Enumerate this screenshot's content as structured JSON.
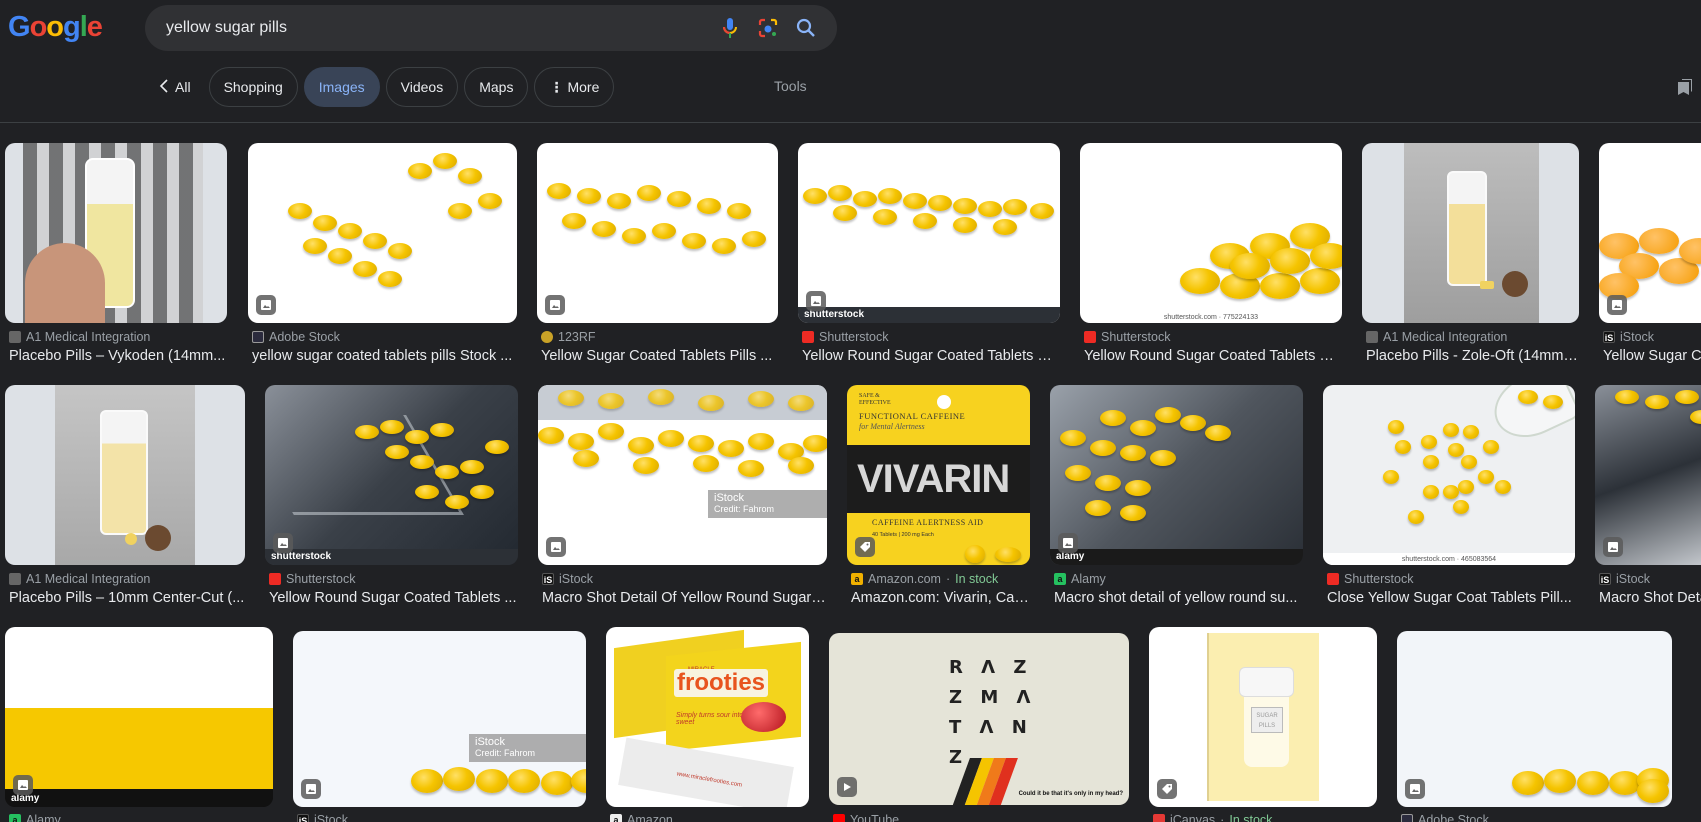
{
  "header": {
    "logo_letters": [
      "G",
      "o",
      "o",
      "g",
      "l",
      "e"
    ],
    "search": {
      "value": "yellow sugar pills",
      "placeholder": ""
    },
    "icons": {
      "voice": "microphone-icon",
      "lens": "lens-camera-icon",
      "search": "search-icon"
    }
  },
  "tabs": {
    "back_label": "All",
    "chips": [
      {
        "label": "Shopping",
        "active": false
      },
      {
        "label": "Images",
        "active": true
      },
      {
        "label": "Videos",
        "active": false
      },
      {
        "label": "Maps",
        "active": false
      },
      {
        "label": "More",
        "active": false
      }
    ],
    "tools_label": "Tools",
    "saved_icon": "saved-bookmarks-icon"
  },
  "colors": {
    "background": "#202124",
    "active_chip_bg": "#394457",
    "active_chip_text": "#8ab4f8",
    "in_stock": "#81c995",
    "pill_yellow": "#f5c400"
  },
  "results": {
    "row1": [
      {
        "source": "A1 Medical Integration",
        "title": "Placebo Pills – Vykoden (14mm...",
        "badge": "image-icon"
      },
      {
        "source": "Adobe Stock",
        "title": "yellow sugar coated tablets pills Stock ...",
        "badge": "image-icon"
      },
      {
        "source": "123RF",
        "title": "Yellow Sugar Coated Tablets Pills ...",
        "badge": "image-icon"
      },
      {
        "source": "Shutterstock",
        "title": "Yellow Round Sugar Coated Tablets Pi...",
        "badge": "image-icon",
        "watermark": "shutterstock"
      },
      {
        "source": "Shutterstock",
        "title": "Yellow Round Sugar Coated Tablets Pi...",
        "watermark": "shutterstock.com · 775224133"
      },
      {
        "source": "A1 Medical Integration",
        "title": "Placebo Pills - Zole-Oft (14mm ..."
      },
      {
        "source": "iStock",
        "title": "Yellow Sugar Co",
        "badge": "image-icon"
      }
    ],
    "row2": [
      {
        "source": "A1 Medical Integration",
        "title": "Placebo Pills – 10mm Center-Cut (..."
      },
      {
        "source": "Shutterstock",
        "title": "Yellow Round Sugar Coated Tablets ...",
        "badge": "image-icon",
        "watermark": "shutterstock"
      },
      {
        "source": "iStock",
        "title": "Macro Shot Detail Of Yellow Round Sugar ...",
        "badge": "image-icon",
        "overlay_title": "iStock",
        "overlay_credit": "Credit: Fahrom"
      },
      {
        "source": "Amazon.com",
        "stock": "In stock",
        "title": "Amazon.com: Vivarin, Caf...",
        "badge": "price-tag-icon",
        "product": {
          "tag1": "SAFE &",
          "tag2": "EFFECTIVE",
          "line1": "FUNCTIONAL CAFFEINE",
          "line2": "for Mental Alertness",
          "brand": "VIVARIN",
          "subtitle": "CAFFEINE ALERTNESS AID",
          "count": "40 Tablets | 200 mg Each"
        }
      },
      {
        "source": "Alamy",
        "title": "Macro shot detail of yellow round su...",
        "badge": "image-icon",
        "watermark": "alamy"
      },
      {
        "source": "Shutterstock",
        "title": "Close Yellow Sugar Coat Tablets Pill...",
        "watermark": "shutterstock.com · 465083564"
      },
      {
        "source": "iStock",
        "title": "Macro Shot Deta",
        "badge": "image-icon"
      }
    ],
    "row3": [
      {
        "source": "Alamy",
        "badge": "image-icon",
        "watermark": "alamy"
      },
      {
        "source": "iStock",
        "badge": "image-icon",
        "overlay_title": "iStock",
        "overlay_credit": "Credit: Fahrom"
      },
      {
        "source": "Amazon",
        "product": {
          "brand_top": "MIRACLE",
          "brand": "frooties",
          "tagline": "Simply turns sour into sweet",
          "url": "www.miraclefrooties.com"
        }
      },
      {
        "source": "YouTube",
        "badge": "play-icon",
        "video": {
          "lines": [
            "R Λ Z",
            "Z M Λ",
            "T Λ N",
            "Z"
          ],
          "caption": "Could it be that it's only in my head?"
        }
      },
      {
        "source": "iCanvas",
        "stock": "In stock",
        "badge": "price-tag-icon",
        "product": {
          "label_line1": "SUGAR",
          "label_line2": "PILLS"
        }
      },
      {
        "source": "Adobe Stock",
        "badge": "image-icon"
      }
    ]
  }
}
